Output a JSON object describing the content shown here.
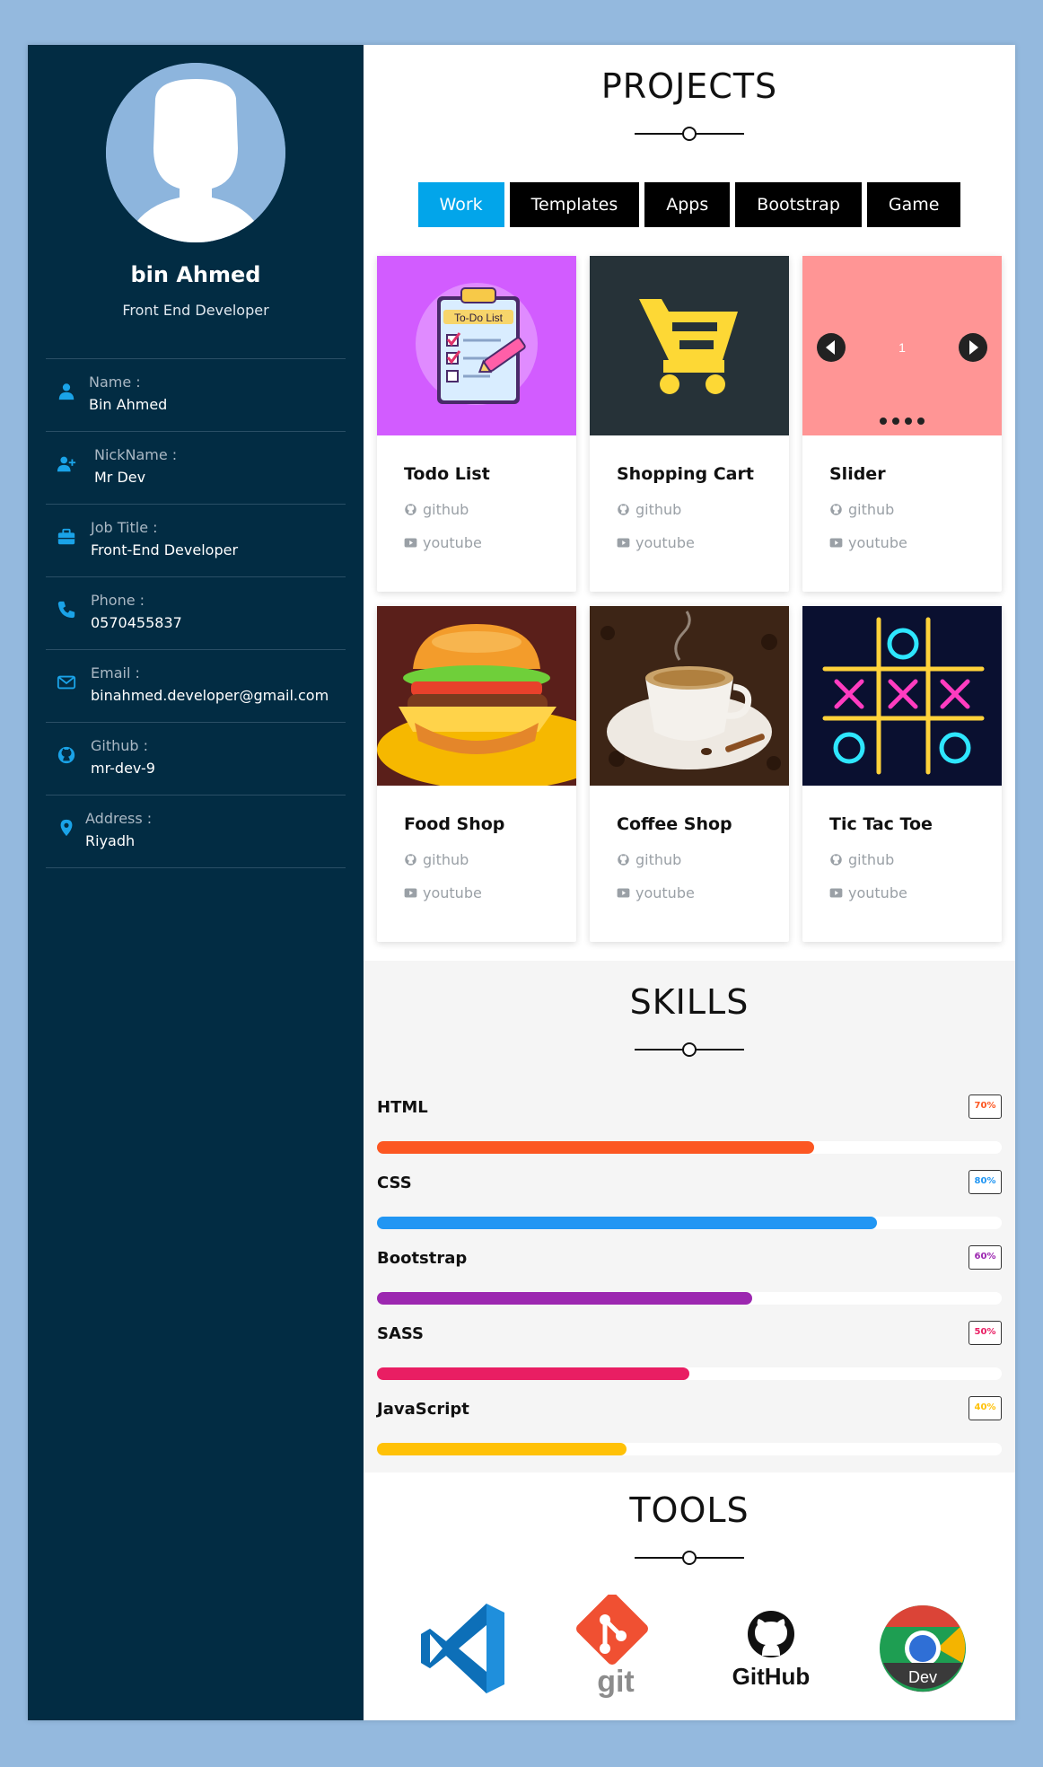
{
  "profile": {
    "name": "bin Ahmed",
    "role": "Front End Developer",
    "details": [
      {
        "icon": "user-icon",
        "label": "Name :",
        "value": "Bin Ahmed"
      },
      {
        "icon": "user-plus-icon",
        "label": "NickName :",
        "value": "Mr Dev"
      },
      {
        "icon": "briefcase-icon",
        "label": "Job Title :",
        "value": "Front-End Developer"
      },
      {
        "icon": "phone-icon",
        "label": "Phone :",
        "value": "0570455837"
      },
      {
        "icon": "envelope-icon",
        "label": "Email :",
        "value": "binahmed.developer@gmail.com"
      },
      {
        "icon": "github-icon",
        "label": "Github :",
        "value": "mr-dev-9"
      },
      {
        "icon": "map-pin-icon",
        "label": "Address :",
        "value": "Riyadh"
      }
    ]
  },
  "projects": {
    "title": "PROJECTS",
    "tabs": [
      {
        "label": "Work",
        "active": true
      },
      {
        "label": "Templates",
        "active": false
      },
      {
        "label": "Apps",
        "active": false
      },
      {
        "label": "Bootstrap",
        "active": false
      },
      {
        "label": "Game",
        "active": false
      }
    ],
    "items": [
      {
        "name": "Todo List",
        "github": "github",
        "youtube": "youtube",
        "thumb_text": "To-Do List"
      },
      {
        "name": "Shopping Cart",
        "github": "github",
        "youtube": "youtube"
      },
      {
        "name": "Slider",
        "github": "github",
        "youtube": "youtube",
        "thumb_text": "1"
      },
      {
        "name": "Food Shop",
        "github": "github",
        "youtube": "youtube"
      },
      {
        "name": "Coffee Shop",
        "github": "github",
        "youtube": "youtube"
      },
      {
        "name": "Tic Tac Toe",
        "github": "github",
        "youtube": "youtube"
      }
    ]
  },
  "skills": {
    "title": "SKILLS",
    "items": [
      {
        "name": "HTML",
        "percent": 70,
        "label": "70%",
        "color": "#fc5722"
      },
      {
        "name": "CSS",
        "percent": 80,
        "label": "80%",
        "color": "#2196f3"
      },
      {
        "name": "Bootstrap",
        "percent": 60,
        "label": "60%",
        "color": "#9c27b0"
      },
      {
        "name": "SASS",
        "percent": 50,
        "label": "50%",
        "color": "#e91e63"
      },
      {
        "name": "JavaScript",
        "percent": 40,
        "label": "40%",
        "color": "#ffc107"
      }
    ]
  },
  "tools": {
    "title": "TOOLS",
    "items": [
      {
        "icon": "vscode-icon"
      },
      {
        "icon": "git-icon",
        "text": "git"
      },
      {
        "icon": "github-logo-icon",
        "text": "GitHub"
      },
      {
        "icon": "chrome-dev-icon",
        "text": "Dev"
      }
    ]
  },
  "colors": {
    "sidebar": "#022c43",
    "accent": "#02a5ea",
    "page": "#94b9de"
  }
}
